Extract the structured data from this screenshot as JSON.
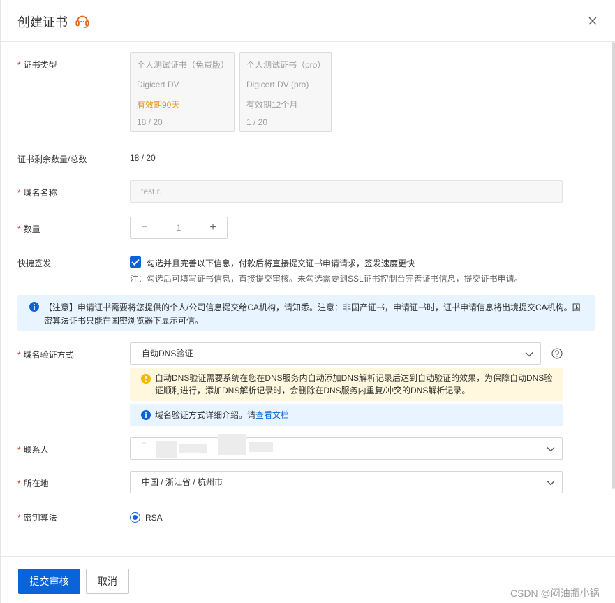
{
  "header": {
    "title": "创建证书"
  },
  "form": {
    "cert_type": {
      "label": "证书类型",
      "cards": [
        {
          "name": "个人测试证书（免费版）",
          "product": "Digicert DV",
          "validity": "有效期90天",
          "count": "18 / 20"
        },
        {
          "name": "个人测试证书（pro）",
          "product": "Digicert DV (pro)",
          "validity": "有效期12个月",
          "count": "1 / 20"
        }
      ]
    },
    "remaining": {
      "label": "证书剩余数量/总数",
      "value": "18 / 20"
    },
    "domain": {
      "label": "域名名称",
      "value": "test.r."
    },
    "quantity": {
      "label": "数量",
      "value": "1",
      "minus": "−",
      "plus": "+"
    },
    "quick_issue": {
      "label": "快捷签发",
      "checked": true,
      "text": "勾选并且完善以下信息，付款后将直接提交证书申请请求，签发速度更快",
      "note": "注：勾选后可填写证书信息，直接提交审核。未勾选需要到SSL证书控制台完善证书信息，提交证书申请。"
    },
    "notice": "【注意】申请证书需要将您提供的个人/公司信息提交给CA机构，请知悉。注意：非国产证书，申请证书时，证书申请信息将出境提交CA机构。国密算法证书只能在国密浏览器下显示可信。",
    "verify_method": {
      "label": "域名验证方式",
      "value": "自动DNS验证",
      "warning": "自动DNS验证需要系统在您在DNS服务内自动添加DNS解析记录后达到自动验证的效果，为保障自动DNS验证顺利进行，添加DNS解析记录时，会删除在DNS服务内重复/冲突的DNS解析记录。",
      "doc_text": "域名验证方式详细介绍。请",
      "doc_link": "查看文档"
    },
    "contact": {
      "label": "联系人",
      "value": ""
    },
    "location": {
      "label": "所在地",
      "value": "中国 / 浙江省 / 杭州市"
    },
    "algorithm": {
      "label": "密钥算法",
      "value": "RSA"
    }
  },
  "footer": {
    "submit": "提交审核",
    "cancel": "取消",
    "watermark": "CSDN @闷油瓶小锅"
  },
  "colors": {
    "primary": "#0a64d8",
    "required": "#d93026",
    "highlight": "#e39a1b",
    "info_bg": "#e8f4ff",
    "warn_bg": "#fff8de"
  }
}
